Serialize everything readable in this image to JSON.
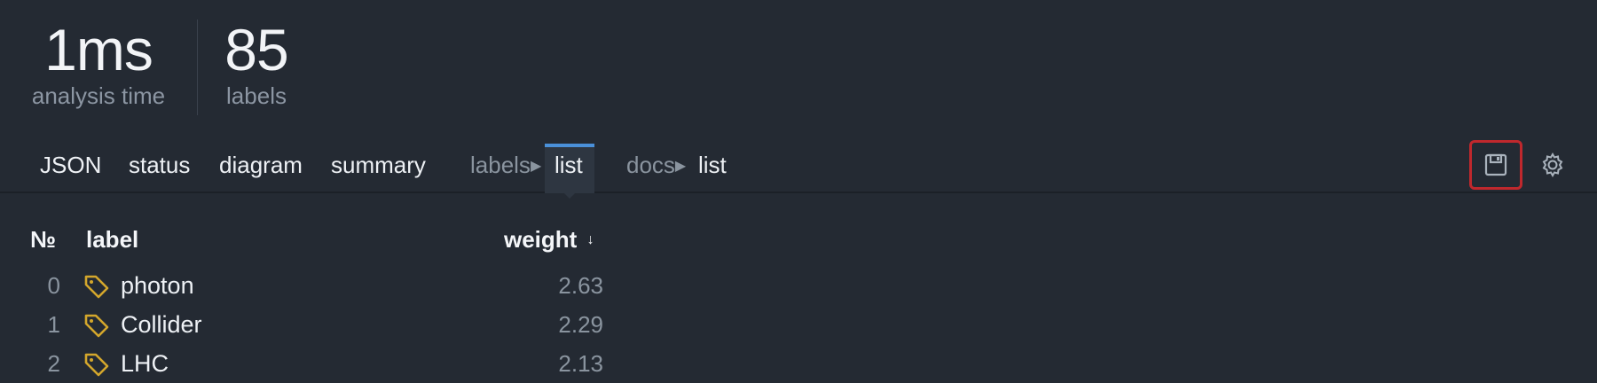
{
  "stats": {
    "analysis_time": {
      "value": "1ms",
      "label": "analysis time"
    },
    "labels": {
      "value": "85",
      "label": "labels"
    }
  },
  "tabs": {
    "json": "JSON",
    "status": "status",
    "diagram": "diagram",
    "summary": "summary",
    "labels_crumb": "labels",
    "labels_list": "list",
    "docs_crumb": "docs",
    "docs_list": "list",
    "arrow": "▶"
  },
  "icons": {
    "save": "save-icon",
    "settings": "gear-icon",
    "tag": "tag-icon"
  },
  "colors": {
    "background": "#242a33",
    "accent_tab": "#4a90d9",
    "tag_icon": "#d4a72c",
    "save_highlight": "#c0282d"
  },
  "table": {
    "headers": {
      "num": "№",
      "label": "label",
      "weight": "weight",
      "sort_indicator": "↓"
    },
    "rows": [
      {
        "num": "0",
        "label": "photon",
        "weight": "2.63"
      },
      {
        "num": "1",
        "label": "Collider",
        "weight": "2.29"
      },
      {
        "num": "2",
        "label": "LHC",
        "weight": "2.13"
      }
    ]
  }
}
